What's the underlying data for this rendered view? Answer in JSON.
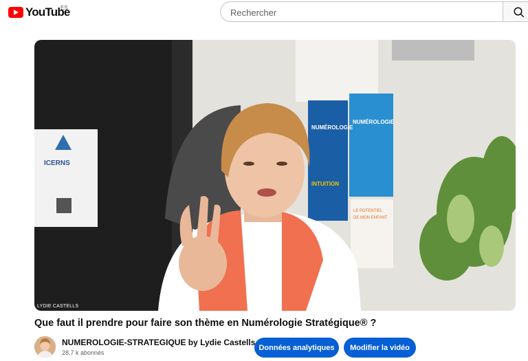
{
  "header": {
    "logo_text": "YouTube",
    "region": "ES",
    "search_placeholder": "Rechercher",
    "search_icon": "search-icon"
  },
  "video": {
    "caption": "LYDIE CASTELLS",
    "poster_left": "ICERNS",
    "books": [
      "NUMÉROLOGIE",
      "NUMÉROLOGIE",
      "INTUITION",
      "LE POTENTIEL DE MON ENFANT NUMÉROLOGIE"
    ]
  },
  "title": "Que faut il prendre pour faire son thème en Numérologie Stratégique® ?",
  "channel": {
    "name": "NUMEROLOGIE-STRATEGIQUE by Lydie Castells",
    "subscribers": "28,7 k abonnés"
  },
  "actions": {
    "analytics_label": "Données analytiques",
    "edit_label": "Modifier la vidéo"
  },
  "colors": {
    "brand_red": "#ff0000",
    "button_blue": "#065fd4"
  }
}
